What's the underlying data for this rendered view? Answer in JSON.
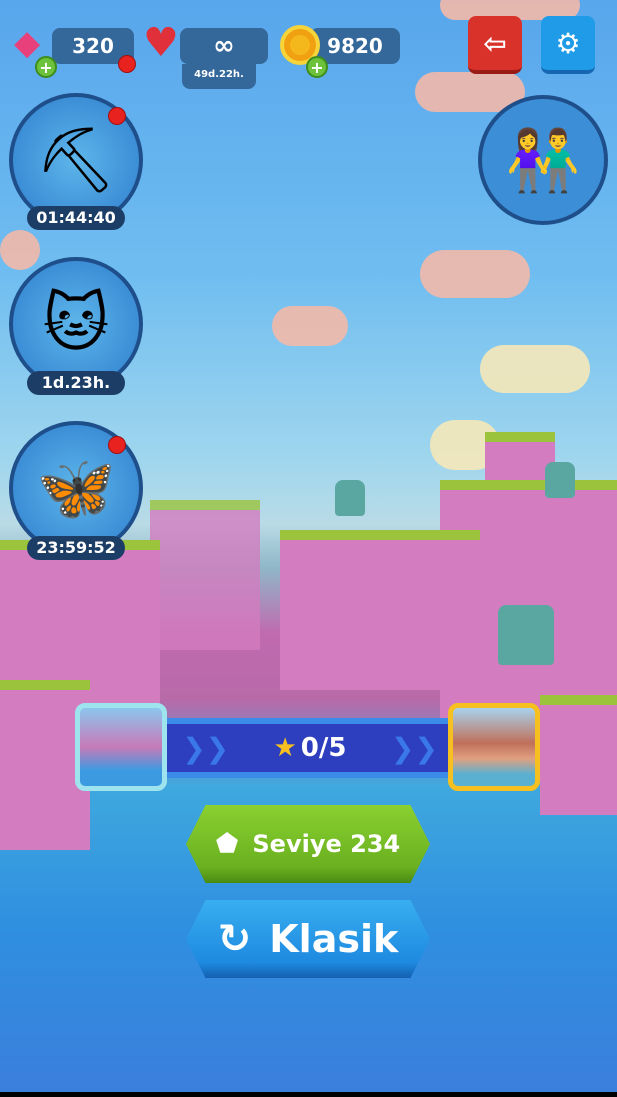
{
  "resources": {
    "gems": {
      "value": "320",
      "icon": "gem-icon"
    },
    "lives": {
      "value": "∞",
      "timer": "49d.22h.",
      "icon": "heart-icon"
    },
    "coins": {
      "value": "9820",
      "icon": "coin-icon"
    }
  },
  "buttons": {
    "exit_icon": "exit-icon",
    "settings_icon": "gear-icon"
  },
  "events": [
    {
      "name": "treasure-mining",
      "timer": "01:44:40",
      "has_notification": true
    },
    {
      "name": "lucky-cat",
      "timer": "1d.23h.",
      "has_notification": false
    },
    {
      "name": "butterfly-jar",
      "timer": "23:59:52",
      "has_notification": true
    }
  ],
  "progress": {
    "text": "0/5",
    "current": 0,
    "total": 5
  },
  "level_button": {
    "label": "Seviye 234"
  },
  "mode_button": {
    "label": "Klasik"
  },
  "colors": {
    "green": "#7cc22a",
    "blue": "#2f9be8",
    "red": "#d9322a",
    "progress_bar": "#2d3fbf"
  }
}
